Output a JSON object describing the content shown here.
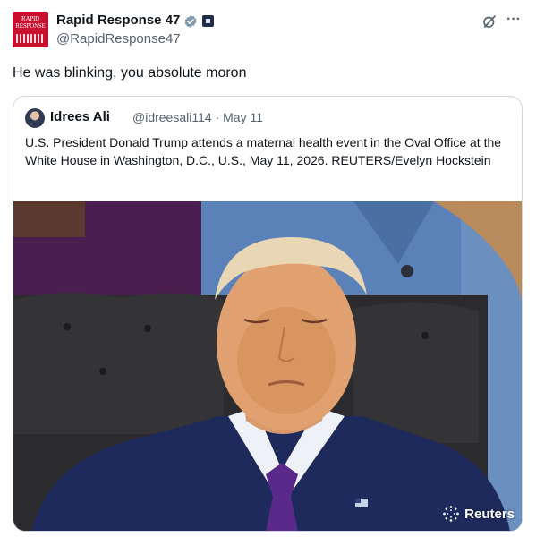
{
  "post": {
    "author": {
      "display_name": "Rapid Response 47",
      "handle": "@RapidResponse47",
      "avatar_text": "RAPID RESPONSE",
      "verified_badge": "verified-icon",
      "affiliation_badge": "affiliation-badge-icon"
    },
    "text": "He was blinking, you absolute moron",
    "actions": {
      "grok_icon": "grok-icon",
      "more_label": "···"
    }
  },
  "quoted_post": {
    "author": {
      "display_name": "Idrees Ali",
      "handle": "@idreesali114",
      "separator": "·",
      "date": "May 11"
    },
    "text": "U.S. President Donald Trump attends a maternal health event in the Oval Office at the White House in Washington, D.C., U.S., May 11, 2026. REUTERS/Evelyn Hockstein",
    "media": {
      "type": "photo",
      "credit_label": "Reuters"
    }
  },
  "colors": {
    "text_primary": "#0f1419",
    "text_secondary": "#536471",
    "border": "#cfd9de",
    "verified_blue": "#829aab",
    "avatar_red": "#c8102e"
  }
}
